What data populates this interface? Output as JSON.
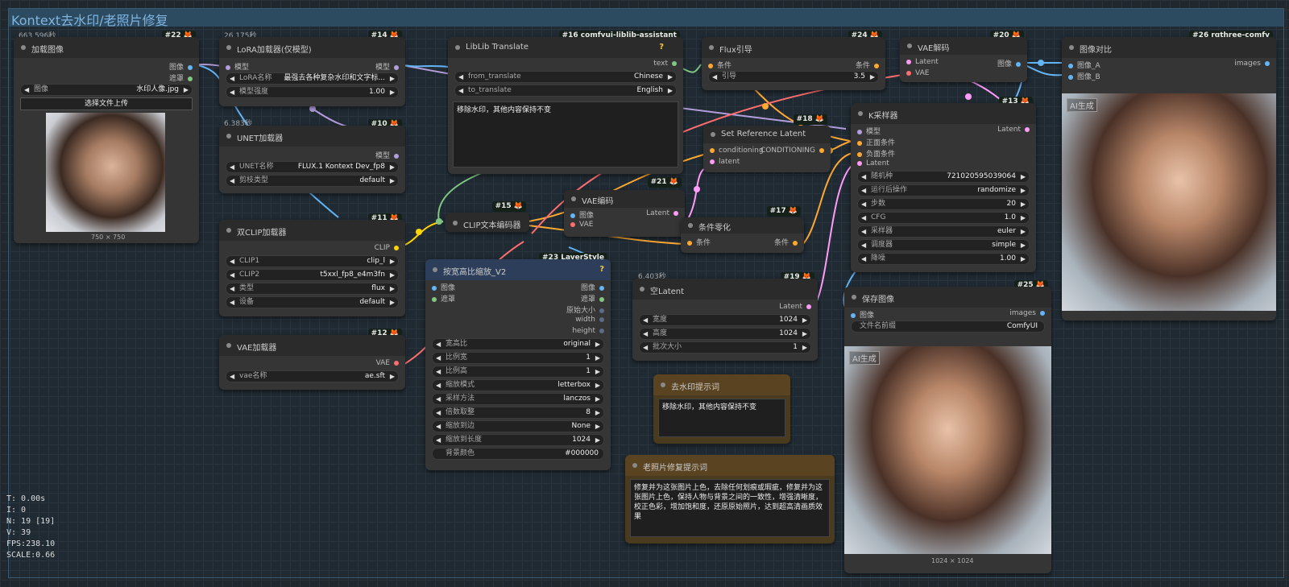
{
  "group": {
    "title": "Kontext去水印/老照片修复"
  },
  "timers": {
    "n22": "663.596秒",
    "n14": "26.175秒",
    "n10": "6.383秒",
    "n19": "6.403秒"
  },
  "nodes": {
    "n22": {
      "badge": "#22",
      "title": "加载图像",
      "out1": "图像",
      "out2": "遮罩",
      "image_label": "图像",
      "image_value": "水印人像.jpg",
      "upload": "选择文件上传",
      "size": "750 × 750"
    },
    "n14": {
      "badge": "#14",
      "title": "LoRA加载器(仅模型)",
      "in1": "模型",
      "out1": "模型",
      "w1_label": "LoRA名称",
      "w1_value": "最强去各种复杂水印和文字标...",
      "w2_label": "模型强度",
      "w2_value": "1.00"
    },
    "n10": {
      "badge": "#10",
      "title": "UNET加载器",
      "out1": "模型",
      "w1_label": "UNET名称",
      "w1_value": "FLUX.1 Kontext Dev_fp8",
      "w2_label": "剪枝类型",
      "w2_value": "default"
    },
    "n11": {
      "badge": "#11",
      "title": "双CLIP加载器",
      "out1": "CLIP",
      "w1_label": "CLIP1",
      "w1_value": "clip_l",
      "w2_label": "CLIP2",
      "w2_value": "t5xxl_fp8_e4m3fn",
      "w3_label": "类型",
      "w3_value": "flux",
      "w4_label": "设备",
      "w4_value": "default"
    },
    "n12": {
      "badge": "#12",
      "title": "VAE加载器",
      "out1": "VAE",
      "w1_label": "vae名称",
      "w1_value": "ae.sft"
    },
    "n16": {
      "badge": "#16 comfyui-liblib-assistant",
      "title": "LibLib Translate",
      "help": "?",
      "out1": "text",
      "w1_label": "from_translate",
      "w1_value": "Chinese",
      "w2_label": "to_translate",
      "w2_value": "English",
      "text": "移除水印，其他内容保持不变"
    },
    "n15": {
      "badge": "#15",
      "title": "CLIP文本编码器"
    },
    "n21": {
      "badge": "#21",
      "title": "VAE编码",
      "in1": "图像",
      "in2": "VAE",
      "out1": "Latent"
    },
    "n23": {
      "badge": "#23 LayerStyle",
      "title": "按宽高比缩放_V2",
      "help": "?",
      "in1": "图像",
      "in2": "遮罩",
      "out1": "图像",
      "out2": "遮罩",
      "out3": "原始大小",
      "out4": "width",
      "out5": "height",
      "w1_label": "宽高比",
      "w1_value": "original",
      "w2_label": "比例宽",
      "w2_value": "1",
      "w3_label": "比例高",
      "w3_value": "1",
      "w4_label": "缩放模式",
      "w4_value": "letterbox",
      "w5_label": "采样方法",
      "w5_value": "lanczos",
      "w6_label": "倍数取整",
      "w6_value": "8",
      "w7_label": "缩放到边",
      "w7_value": "None",
      "w8_label": "缩放到长度",
      "w8_value": "1024",
      "w9_label": "背景颜色",
      "w9_value": "#000000"
    },
    "n24": {
      "badge": "#24",
      "title": "Flux引导",
      "in1": "条件",
      "out1": "条件",
      "w1_label": "引导",
      "w1_value": "3.5"
    },
    "n18": {
      "badge": "#18",
      "title": "Set Reference Latent",
      "in1": "conditioning",
      "in2": "latent",
      "out1": "CONDITIONING"
    },
    "n17": {
      "badge": "#17",
      "title": "条件零化",
      "in1": "条件",
      "out1": "条件"
    },
    "n19": {
      "badge": "#19",
      "title": "空Latent",
      "out1": "Latent",
      "w1_label": "宽度",
      "w1_value": "1024",
      "w2_label": "高度",
      "w2_value": "1024",
      "w3_label": "批次大小",
      "w3_value": "1"
    },
    "n20": {
      "badge": "#20",
      "title": "VAE解码",
      "in1": "Latent",
      "in2": "VAE",
      "out1": "图像"
    },
    "n13": {
      "badge": "#13",
      "title": "K采样器",
      "in1": "模型",
      "in2": "正面条件",
      "in3": "负面条件",
      "in4": "Latent",
      "out1": "Latent",
      "w1_label": "随机种",
      "w1_value": "721020595039064",
      "w2_label": "运行后操作",
      "w2_value": "randomize",
      "w3_label": "步数",
      "w3_value": "20",
      "w4_label": "CFG",
      "w4_value": "1.0",
      "w5_label": "采样器",
      "w5_value": "euler",
      "w6_label": "调度器",
      "w6_value": "simple",
      "w7_label": "降噪",
      "w7_value": "1.00"
    },
    "n26": {
      "badge": "#26 rgthree-comfy",
      "title": "图像对比",
      "in1": "图像_A",
      "in2": "图像_B",
      "out1": "images",
      "ai": "AI生成"
    },
    "n25": {
      "badge": "#25",
      "title": "保存图像",
      "in1": "图像",
      "out1": "images",
      "w1_label": "文件名前缀",
      "w1_value": "ComfyUI",
      "ai": "AI生成",
      "size": "1024 × 1024"
    },
    "note1": {
      "title": "去水印提示词",
      "text": "移除水印，其他内容保持不变"
    },
    "note2": {
      "title": "老照片修复提示词",
      "text": "修复并为这张图片上色，去除任何划痕或瑕疵，修复并为这张图片上色，保持人物与背景之间的一致性，增强清晰度，校正色彩，增加饱和度，还原原始照片，达到超高清画质效果"
    }
  },
  "stats": {
    "t": "T: 0.00s",
    "i": "I: 0",
    "n": "N: 19 [19]",
    "v": "V: 39",
    "fps": "FPS:238.10",
    "scale": "SCALE:0.66"
  },
  "colors": {
    "image": "#64b5f6",
    "mask": "#81c784",
    "model": "#b39ddb",
    "clip": "#ffd500",
    "vae": "#ff6e6e",
    "cond": "#ffa931",
    "latent": "#ff9cf9"
  }
}
